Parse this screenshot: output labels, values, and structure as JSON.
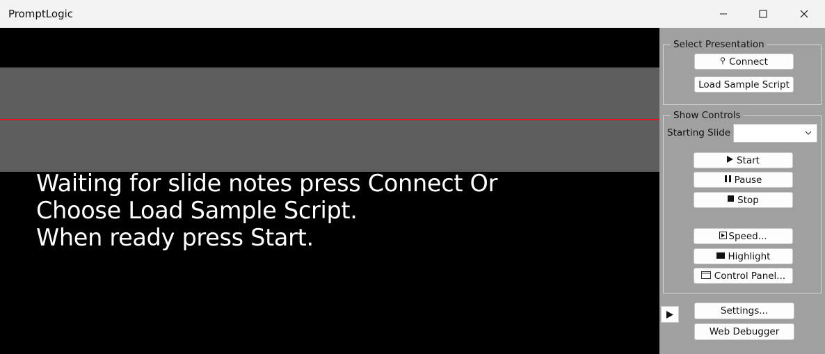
{
  "window": {
    "title": "PromptLogic",
    "minimize_icon": "minimize-icon",
    "maximize_icon": "maximize-icon",
    "close_icon": "close-icon"
  },
  "teleprompter": {
    "message": "Waiting for slide notes press Connect Or\nChoose Load Sample Script.\nWhen ready press Start.",
    "band_color": "#5e5e5e",
    "reading_line_color": "#e81123",
    "background": "#000000"
  },
  "select_presentation": {
    "title": "Select Presentation",
    "connect_label": "Connect",
    "connect_icon": "plug-icon",
    "load_sample_label": "Load Sample Script"
  },
  "show_controls": {
    "title": "Show Controls",
    "starting_slide_label": "Starting Slide",
    "starting_slide_value": "",
    "start_label": "Start",
    "pause_label": "Pause",
    "stop_label": "Stop",
    "speed_label": "Speed...",
    "highlight_label": "Highlight",
    "control_panel_label": "Control Panel..."
  },
  "footer": {
    "settings_label": "Settings...",
    "web_debugger_label": "Web Debugger"
  }
}
